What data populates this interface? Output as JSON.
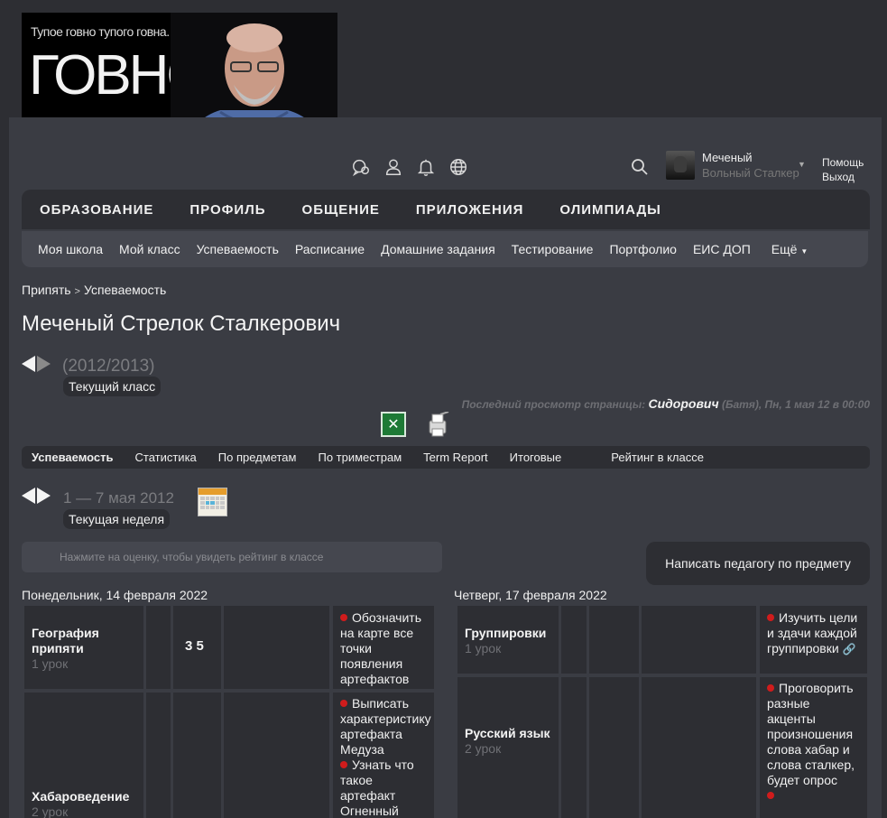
{
  "banner": {
    "tagline": "Тупое говно тупого говна.",
    "big_text": "ГОВНО."
  },
  "header_icons": [
    "chat-icon",
    "user-icon",
    "bell-icon",
    "globe-icon"
  ],
  "user": {
    "name": "Меченый",
    "rank": "Вольный Сталкер",
    "help": "Помощь",
    "logout": "Выход"
  },
  "mainnav": [
    "ОБРАЗОВАНИЕ",
    "ПРОФИЛЬ",
    "ОБЩЕНИЕ",
    "ПРИЛОЖЕНИЯ",
    "ОЛИМПИАДЫ"
  ],
  "subnav": [
    "Моя школа",
    "Мой класс",
    "Успеваемость",
    "Расписание",
    "Домашние задания",
    "Тестирование",
    "Портфолио",
    "ЕИС ДОП"
  ],
  "subnav_more": "Ещё",
  "breadcrumb": {
    "root": "Припять",
    "sep": ">",
    "current": "Успеваемость"
  },
  "student_name": "Меченый Стрелок Сталкерович",
  "year": {
    "text": "(2012/2013)",
    "label": "Текущий класс"
  },
  "last_view": {
    "prefix": "Последний просмотр страницы:",
    "who": "Сидорович",
    "suffix": "(Батя), Пн, 1 мая 12 в 00:00"
  },
  "tabs": [
    "Успеваемость",
    "Статистика",
    "По предметам",
    "По триместрам",
    "Term Report",
    "Итоговые",
    "Рейтинг в классе"
  ],
  "week": {
    "text": "1 — 7 мая 2012",
    "label": "Текущая неделя"
  },
  "hint": "Нажмите на оценку, чтобы увидеть рейтинг в классе",
  "write_button": "Написать педагогу по предмету",
  "days": [
    {
      "title": "Понедельник, 14 февраля 2022",
      "rows": [
        {
          "subject": "География припяти",
          "lessons": "1 урок",
          "marks": "3  5",
          "homework": [
            "Обозначить на карте все точки появления артефактов"
          ]
        },
        {
          "subject": "Хабароведение",
          "lessons": "2 урок",
          "marks": "",
          "homework": [
            "Выписать характеристику артефакта Медуза",
            "Узнать что такое артефакт Огненный"
          ]
        }
      ]
    },
    {
      "title": "Четверг, 17 февраля 2022",
      "rows": [
        {
          "subject": "Группировки",
          "lessons": "1 урок",
          "marks": "",
          "homework": [
            "Изучить цели и здачи каждой группировки"
          ]
        },
        {
          "subject": "Русский язык",
          "lessons": "2 урок",
          "marks": "",
          "homework": [
            "Проговорить разные акценты произношения слова хабар и слова сталкер, будет опрос",
            ""
          ]
        }
      ]
    }
  ]
}
